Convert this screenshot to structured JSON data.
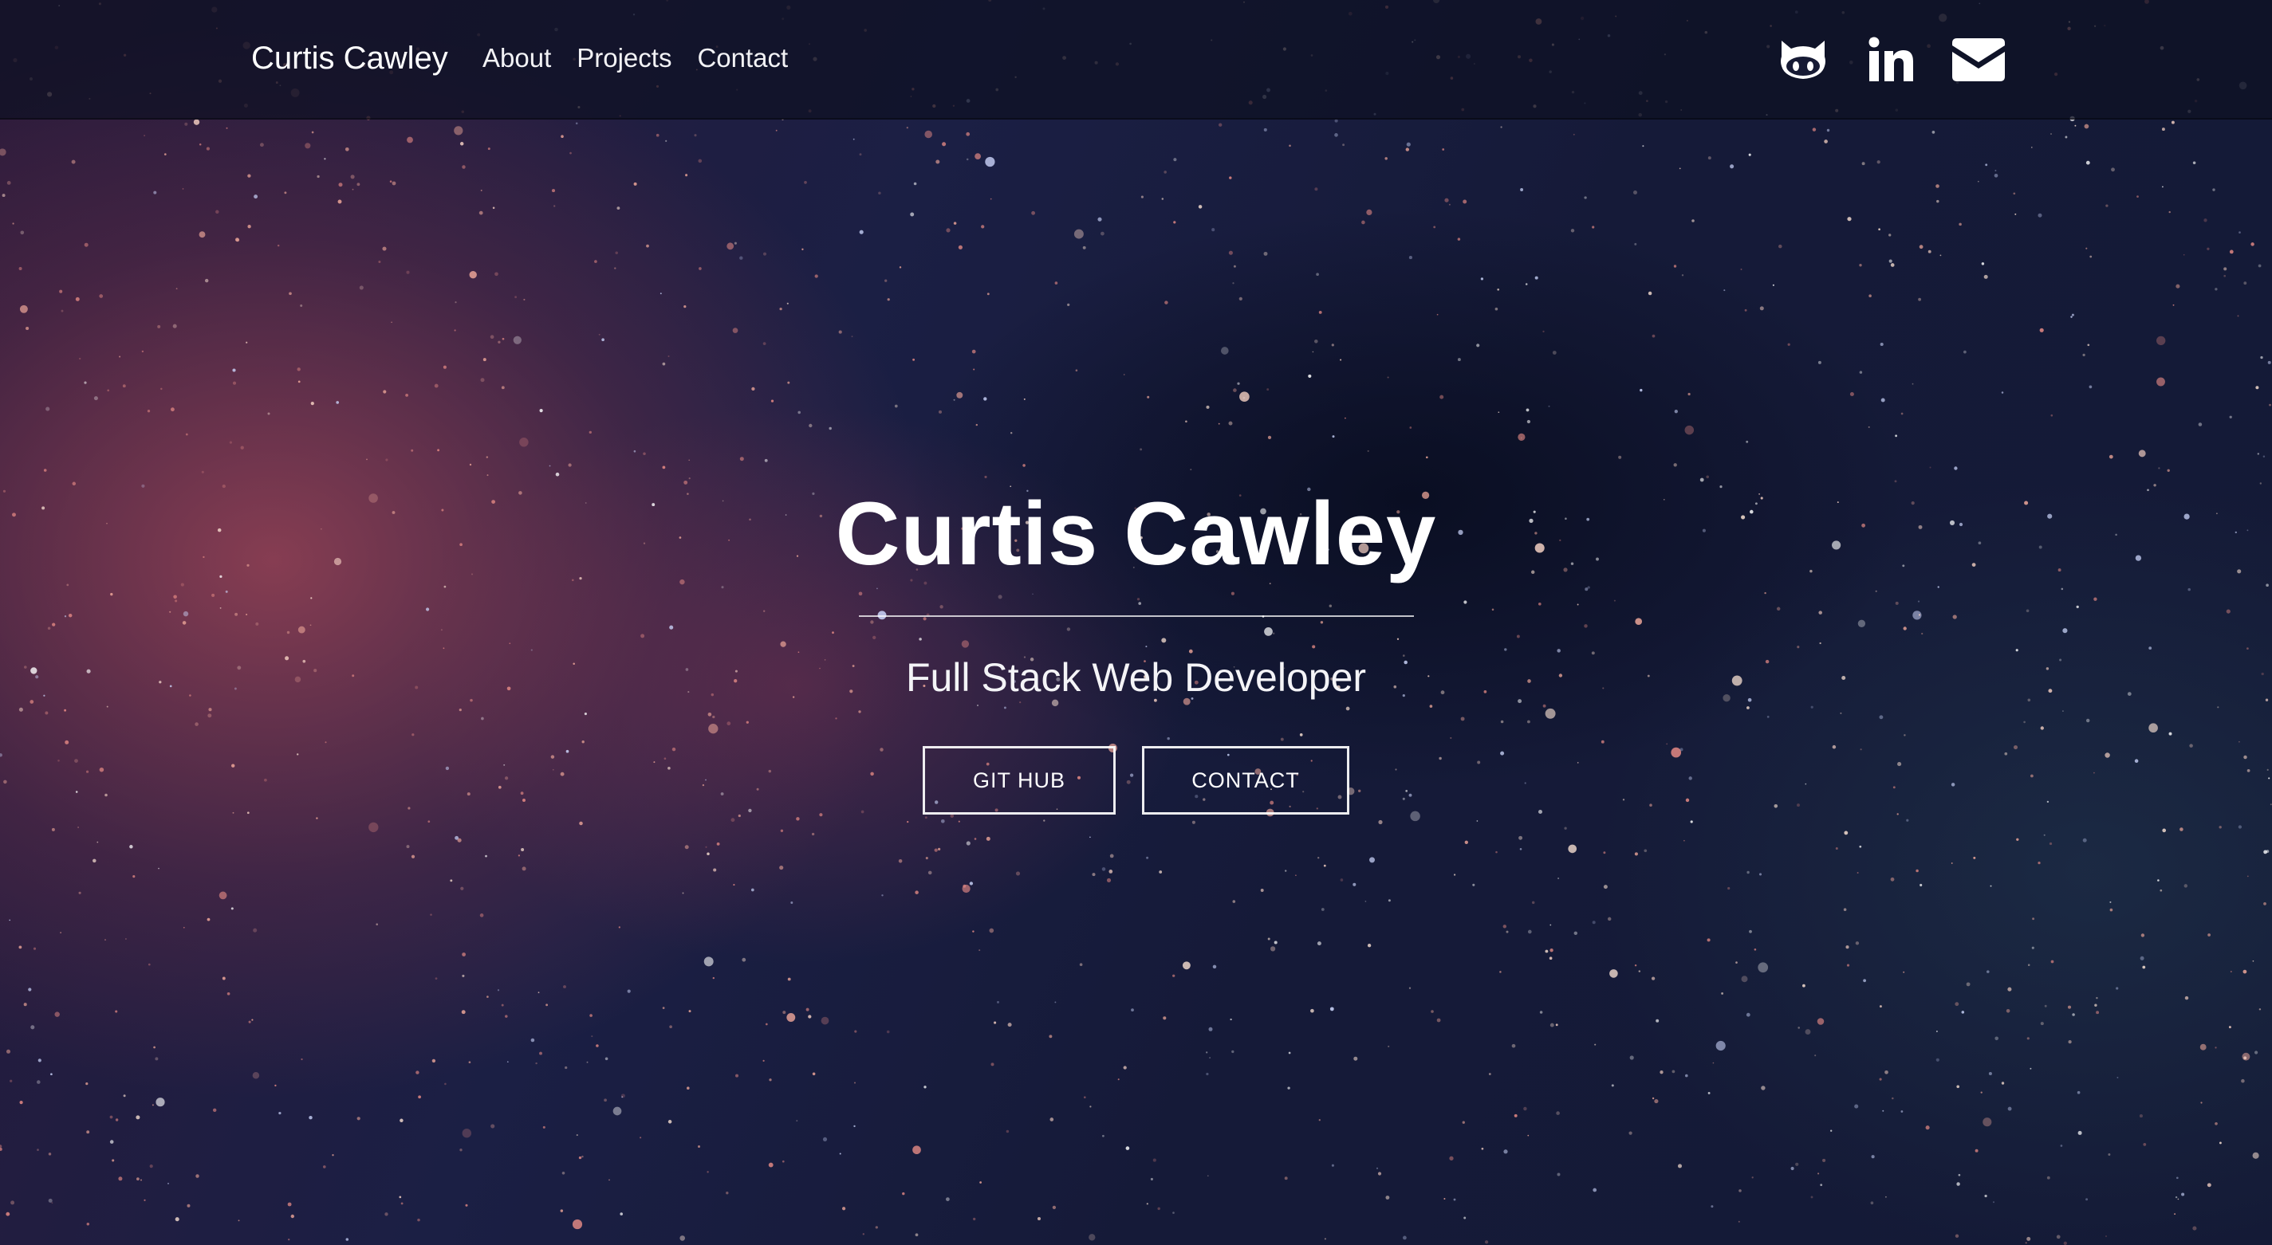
{
  "navbar": {
    "brand": "Curtis Cawley",
    "links": [
      {
        "label": "About"
      },
      {
        "label": "Projects"
      },
      {
        "label": "Contact"
      }
    ],
    "social": [
      {
        "icon": "github-icon"
      },
      {
        "icon": "linkedin-icon"
      },
      {
        "icon": "envelope-icon"
      }
    ]
  },
  "hero": {
    "title": "Curtis Cawley",
    "subtitle": "Full Stack Web Developer",
    "buttons": {
      "github": "GIT HUB",
      "contact": "CONTACT"
    }
  },
  "colors": {
    "text": "#ffffff",
    "navbar_bg": "#0e1022",
    "background_dark": "#151a38",
    "background_warm": "#a84858"
  }
}
